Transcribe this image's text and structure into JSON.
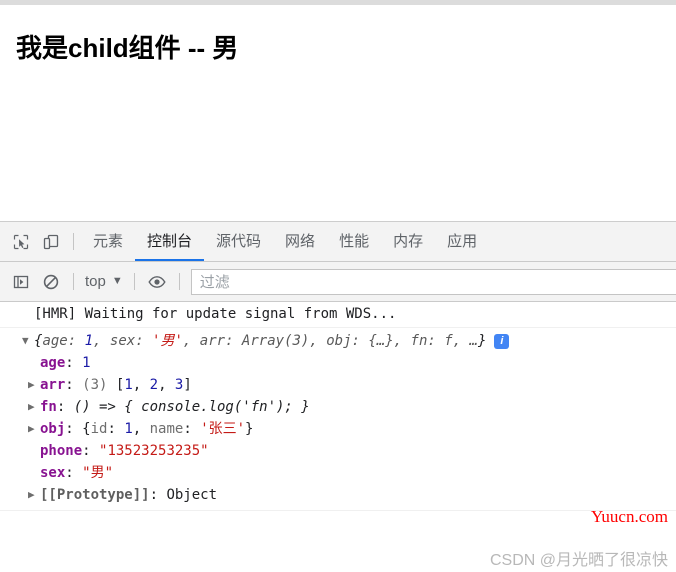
{
  "page": {
    "heading": "我是child组件 -- 男"
  },
  "devtools": {
    "toolbar_icons": {
      "inspect": "inspect-element-icon",
      "device": "device-toolbar-icon"
    },
    "tabs": [
      {
        "label": "元素",
        "active": false
      },
      {
        "label": "控制台",
        "active": true
      },
      {
        "label": "源代码",
        "active": false
      },
      {
        "label": "网络",
        "active": false
      },
      {
        "label": "性能",
        "active": false
      },
      {
        "label": "内存",
        "active": false
      },
      {
        "label": "应用",
        "active": false
      }
    ],
    "console_toolbar": {
      "sidebar_icon": "console-sidebar-icon",
      "clear_icon": "clear-console-icon",
      "context_label": "top",
      "context_caret": "▼",
      "eye_icon": "live-expression-eye-icon",
      "filter_placeholder": "过滤"
    },
    "console": {
      "messages": [
        {
          "type": "log",
          "text": "[HMR] Waiting for update signal from WDS..."
        }
      ],
      "object_preview": {
        "triangle": "▼",
        "open": "{",
        "parts": [
          {
            "key": "age",
            "sep": ": ",
            "value": "1",
            "kind": "num"
          },
          {
            "key": "sex",
            "sep": ": ",
            "value": "'男'",
            "kind": "str"
          },
          {
            "key": "arr",
            "sep": ": ",
            "value": "Array(3)",
            "kind": "plain"
          },
          {
            "key": "obj",
            "sep": ": ",
            "value": "{…}",
            "kind": "plain"
          },
          {
            "key": "fn",
            "sep": ": ",
            "value": "f",
            "kind": "fn"
          }
        ],
        "ellipsis": "…",
        "close": "}",
        "info_badge": "i"
      },
      "properties": [
        {
          "expandable": false,
          "triangle": "",
          "name": "age",
          "colon": ": ",
          "value": "1",
          "kind": "num"
        },
        {
          "expandable": true,
          "triangle": "▶",
          "name": "arr",
          "colon": ": ",
          "value": "(3) [1, 2, 3]",
          "kind": "array",
          "array_count": "(3)",
          "array_items": [
            "1",
            "2",
            "3"
          ]
        },
        {
          "expandable": true,
          "triangle": "▶",
          "name": "fn",
          "colon": ": ",
          "value": "() => { console.log('fn'); }",
          "kind": "function"
        },
        {
          "expandable": true,
          "triangle": "▶",
          "name": "obj",
          "colon": ": ",
          "value": "{id: 1, name: '张三'}",
          "kind": "object",
          "obj_id_key": "id",
          "obj_id_value": "1",
          "obj_name_key": "name",
          "obj_name_value": "'张三'"
        },
        {
          "expandable": false,
          "triangle": "",
          "name": "phone",
          "colon": ": ",
          "value": "\"13523253235\"",
          "kind": "str"
        },
        {
          "expandable": false,
          "triangle": "",
          "name": "sex",
          "colon": ": ",
          "value": "\"男\"",
          "kind": "str"
        },
        {
          "expandable": true,
          "triangle": "▶",
          "name": "[[Prototype]]",
          "colon": ": ",
          "value": "Object",
          "kind": "proto"
        }
      ]
    }
  },
  "watermarks": {
    "yuucn": "Yuucn.com",
    "csdn": "CSDN @月光晒了很凉快"
  },
  "colors": {
    "accent_blue": "#1a73e8",
    "prop_name": "#881391",
    "number": "#1a1aa6",
    "string": "#c41a16",
    "info_badge": "#4285f4",
    "watermark_red": "#ff0000",
    "watermark_grey": "#b8b8b8"
  }
}
